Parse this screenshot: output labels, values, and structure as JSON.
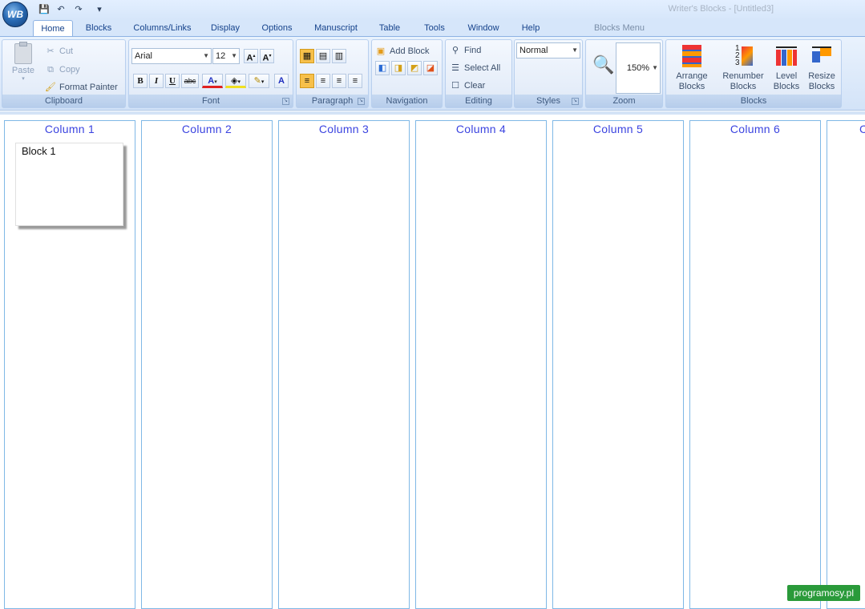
{
  "window": {
    "title": "Writer's Blocks - [Untitled3]"
  },
  "app_orb": {
    "label": "WB"
  },
  "tabs": [
    {
      "label": "Home",
      "active": true
    },
    {
      "label": "Blocks"
    },
    {
      "label": "Columns/Links"
    },
    {
      "label": "Display"
    },
    {
      "label": "Options"
    },
    {
      "label": "Manuscript"
    },
    {
      "label": "Table"
    },
    {
      "label": "Tools"
    },
    {
      "label": "Window"
    },
    {
      "label": "Help"
    }
  ],
  "contextual_tab": "Blocks Menu",
  "ribbon": {
    "clipboard": {
      "label": "Clipboard",
      "paste": "Paste",
      "cut": "Cut",
      "copy": "Copy",
      "format_painter": "Format Painter"
    },
    "font": {
      "label": "Font",
      "family": "Arial",
      "size": "12"
    },
    "paragraph": {
      "label": "Paragraph"
    },
    "navigation": {
      "label": "Navigation",
      "add_block": "Add Block"
    },
    "editing": {
      "label": "Editing",
      "find": "Find",
      "select_all": "Select All",
      "clear": "Clear"
    },
    "styles": {
      "label": "Styles",
      "current": "Normal"
    },
    "zoom": {
      "label": "Zoom",
      "level": "150%"
    },
    "blocks": {
      "label": "Blocks",
      "arrange": [
        "Arrange",
        "Blocks"
      ],
      "renumber": [
        "Renumber",
        "Blocks"
      ],
      "level": [
        "Level",
        "Blocks"
      ],
      "resize": [
        "Resize",
        "Blocks"
      ]
    }
  },
  "columns": [
    {
      "title": "Column  1"
    },
    {
      "title": "Column  2"
    },
    {
      "title": "Column  3"
    },
    {
      "title": "Column  4"
    },
    {
      "title": "Column  5"
    },
    {
      "title": "Column  6"
    },
    {
      "title": "C"
    }
  ],
  "blocks": [
    {
      "title": "Block 1"
    }
  ],
  "watermark": "programosy.pl"
}
